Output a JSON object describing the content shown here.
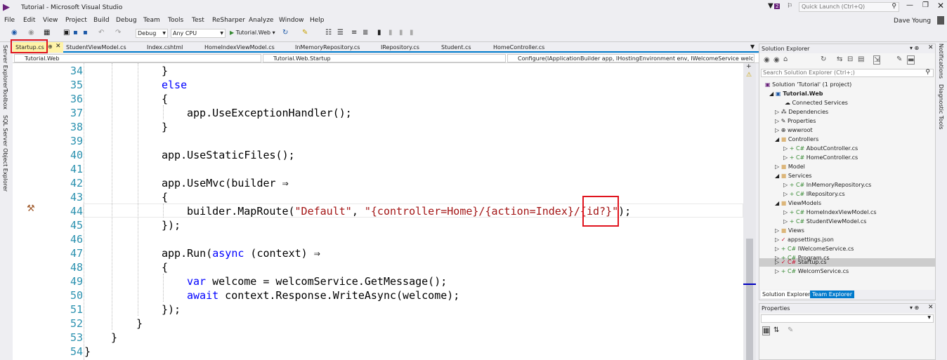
{
  "window": {
    "title": "Tutorial - Microsoft Visual Studio",
    "quick_launch": "Quick Launch (Ctrl+Q)",
    "user": "Dave Young",
    "notification_count": "2"
  },
  "menu": [
    "File",
    "Edit",
    "View",
    "Project",
    "Build",
    "Debug",
    "Team",
    "Tools",
    "Test",
    "ReSharper",
    "Analyze",
    "Window",
    "Help"
  ],
  "toolbar": {
    "config": "Debug",
    "platform": "Any CPU",
    "run": "Tutorial.Web"
  },
  "tabs": [
    "Startup.cs",
    "StudentViewModel.cs",
    "Index.cshtml",
    "HomeIndexViewModel.cs",
    "InMemoryRepository.cs",
    "IRepository.cs",
    "Student.cs",
    "HomeController.cs"
  ],
  "nav": {
    "project": "Tutorial.Web",
    "class": "Tutorial.Web.Startup",
    "member": "Configure(IApplicationBuilder app, IHostingEnvironment env, IWelcomeService welcom"
  },
  "left_tools": [
    "Server Explorer",
    "Toolbox",
    "SQL Server Object Explorer"
  ],
  "right_tools": [
    "Notifications",
    "Diagnostic Tools"
  ],
  "code": {
    "line_numbers": [
      "34",
      "35",
      "36",
      "37",
      "38",
      "39",
      "40",
      "41",
      "42",
      "43",
      "44",
      "45",
      "46",
      "47",
      "48",
      "49",
      "50",
      "51",
      "52",
      "53",
      "54"
    ],
    "l34": "}",
    "l35": "else",
    "l36": "{",
    "l37": "app.UseExceptionHandler();",
    "l38": "}",
    "l40": "app.UseStaticFiles();",
    "l42": "app.UseMvc(builder ⇒",
    "l43": "{",
    "l44a": "builder.MapRoute(",
    "l44b": "\"Default\"",
    "l44c": ", ",
    "l44d": "\"{controller=Home}/{action=Index}/{id?}\"",
    "l44e": ");",
    "l45": "});",
    "l47a": "app.Run(",
    "l47b": "async",
    "l47c": " (context) ⇒",
    "l48": "{",
    "l49a": "var",
    "l49b": " welcome = welcomService.GetMessage();",
    "l50a": "await",
    "l50b": " context.Response.WriteAsync(welcome);",
    "l51": "});",
    "l52": "}",
    "l53": "}",
    "l54": "}"
  },
  "solution_explorer": {
    "title": "Solution Explorer",
    "search": "Search Solution Explorer (Ctrl+;)",
    "items": [
      "Solution 'Tutorial' (1 project)",
      "Tutorial.Web",
      "Connected Services",
      "Dependencies",
      "Properties",
      "wwwroot",
      "Controllers",
      "AboutController.cs",
      "HomeController.cs",
      "Model",
      "Services",
      "InMemoryRepository.cs",
      "IRepository.cs",
      "ViewModels",
      "HomeIndexViewModel.cs",
      "StudentViewModel.cs",
      "Views",
      "appsettings.json",
      "IWelcomeService.cs",
      "Program.cs",
      "Startup.cs",
      "WelcomService.cs"
    ],
    "tabs": [
      "Solution Explorer",
      "Team Explorer"
    ]
  },
  "properties": {
    "title": "Properties"
  }
}
